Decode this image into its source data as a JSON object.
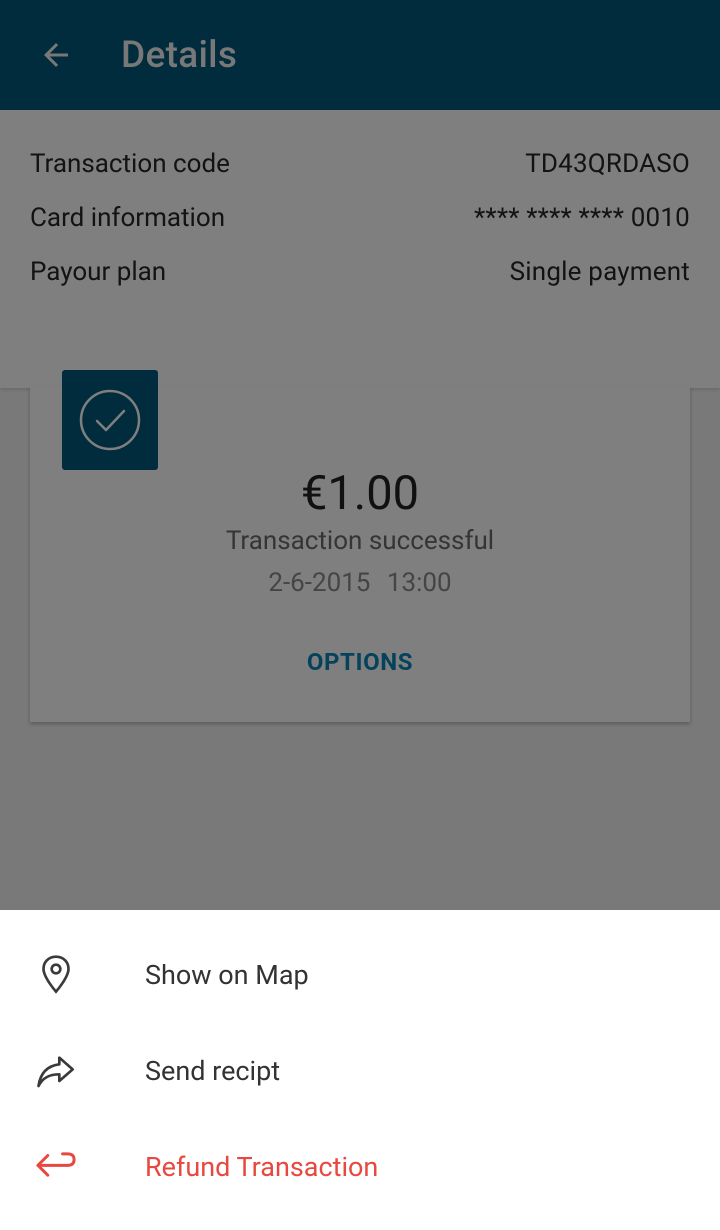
{
  "appbar": {
    "title": "Details",
    "title_color": "#f0f0f0",
    "background": "#00597a"
  },
  "info": [
    {
      "label": "Transaction code",
      "value": "TD43QRDASO"
    },
    {
      "label": "Card information",
      "value": "**** **** **** 0010"
    },
    {
      "label": "Payour plan",
      "value": "Single payment"
    }
  ],
  "card": {
    "amount": "€1.00",
    "status": "Transaction successful",
    "date": "2-6-2015",
    "time": "13:00",
    "datetime": "2-6-2015 13:00",
    "options_label": "OPTIONS",
    "badge_icon": "check-circle-icon"
  },
  "sheet": {
    "items": [
      {
        "label": "Show on Map",
        "icon": "map-pin-icon"
      },
      {
        "label": "Send recipt",
        "icon": "share-arrow-icon"
      },
      {
        "label": "Refund Transaction",
        "icon": "return-arrow-icon",
        "color": "#e8483f"
      }
    ]
  }
}
